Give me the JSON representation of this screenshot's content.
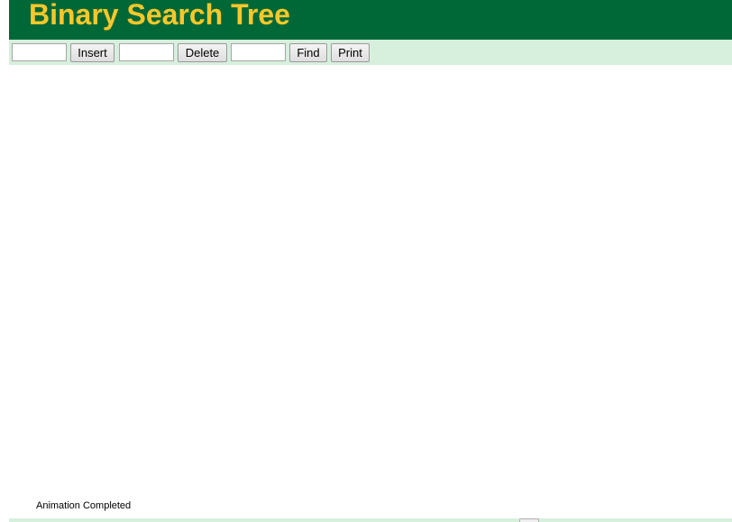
{
  "header": {
    "title": "Binary Search Tree"
  },
  "toolbar": {
    "insert_value": "",
    "insert_label": "Insert",
    "delete_value": "",
    "delete_label": "Delete",
    "find_value": "",
    "find_label": "Find",
    "print_label": "Print"
  },
  "status": {
    "text": "Animation Completed"
  },
  "colors": {
    "header_bg": "#006837",
    "title_text": "#fcc729",
    "toolbar_bg": "#d7efdd"
  }
}
